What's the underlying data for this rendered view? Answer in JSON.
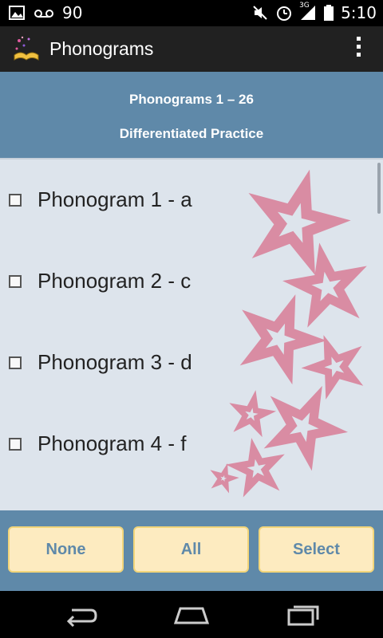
{
  "status_bar": {
    "notification_count": "90",
    "time": "5:10",
    "network": "3G"
  },
  "action_bar": {
    "title": "Phonograms"
  },
  "header": {
    "title": "Phonograms 1 – 26",
    "subtitle": "Differentiated Practice"
  },
  "list": {
    "items": [
      {
        "label": "Phonogram 1 - a",
        "checked": false
      },
      {
        "label": "Phonogram 2 - c",
        "checked": false
      },
      {
        "label": "Phonogram 3 - d",
        "checked": false
      },
      {
        "label": "Phonogram 4 - f",
        "checked": false
      }
    ]
  },
  "buttons": {
    "none_label": "None",
    "all_label": "All",
    "select_label": "Select"
  },
  "colors": {
    "header_blue": "#5f89a9",
    "list_bg": "#dde4ec",
    "button_bg": "#fdebc0",
    "star_pink": "#d98ca3"
  }
}
